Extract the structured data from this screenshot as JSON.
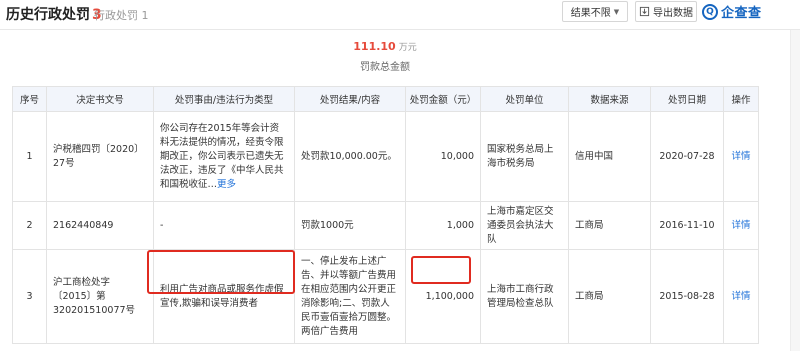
{
  "header": {
    "title": "历史行政处罚",
    "title_count": "3",
    "tab2_label": "行政处罚",
    "tab2_count": "1",
    "filter_label": "结果不限",
    "export_label": "导出数据",
    "logo_text": "企查查",
    "logo_mark": "Q"
  },
  "summary": {
    "amount": "111.10",
    "unit": "万元",
    "label": "罚款总金额"
  },
  "table": {
    "columns": [
      "序号",
      "决定书文号",
      "处罚事由/违法行为类型",
      "处罚结果/内容",
      "处罚金额（元）",
      "处罚单位",
      "数据来源",
      "处罚日期",
      "操作"
    ],
    "rows": [
      {
        "index": "1",
        "doc_no": "沪税稽四罚〔2020〕27号",
        "reason": "你公司存在2015年等会计资料无法提供的情况，经责令限期改正，你公司表示已遗失无法改正，违反了《中华人民共和国税收征…",
        "more": "更多",
        "result": "处罚款10,000.00元。",
        "amount": "10,000",
        "org": "国家税务总局上海市税务局",
        "source": "信用中国",
        "date": "2020-07-28",
        "action": "详情"
      },
      {
        "index": "2",
        "doc_no": "2162440849",
        "reason": "-",
        "more": "",
        "result": "罚款1000元",
        "amount": "1,000",
        "org": "上海市嘉定区交通委员会执法大队",
        "source": "工商局",
        "date": "2016-11-10",
        "action": "详情"
      },
      {
        "index": "3",
        "doc_no": "沪工商检处字〔2015〕第320201510077号",
        "reason": "利用广告对商品或服务作虚假宣传,欺骗和误导消费者",
        "more": "",
        "result": "一、停止发布上述广告、并以等额广告费用在相应范围内公开更正消除影响;二、罚款人民币壹佰壹拾万圆整。两倍广告费用",
        "amount": "1,100,000",
        "org": "上海市工商行政管理局检查总队",
        "source": "工商局",
        "date": "2015-08-28",
        "action": "详情"
      }
    ]
  },
  "colors": {
    "accent_red": "#e64a3b",
    "highlight_red": "#e02b20",
    "link_blue": "#1e70d8",
    "brand_blue": "#1565c0",
    "header_bg": "#f2f5fb"
  }
}
